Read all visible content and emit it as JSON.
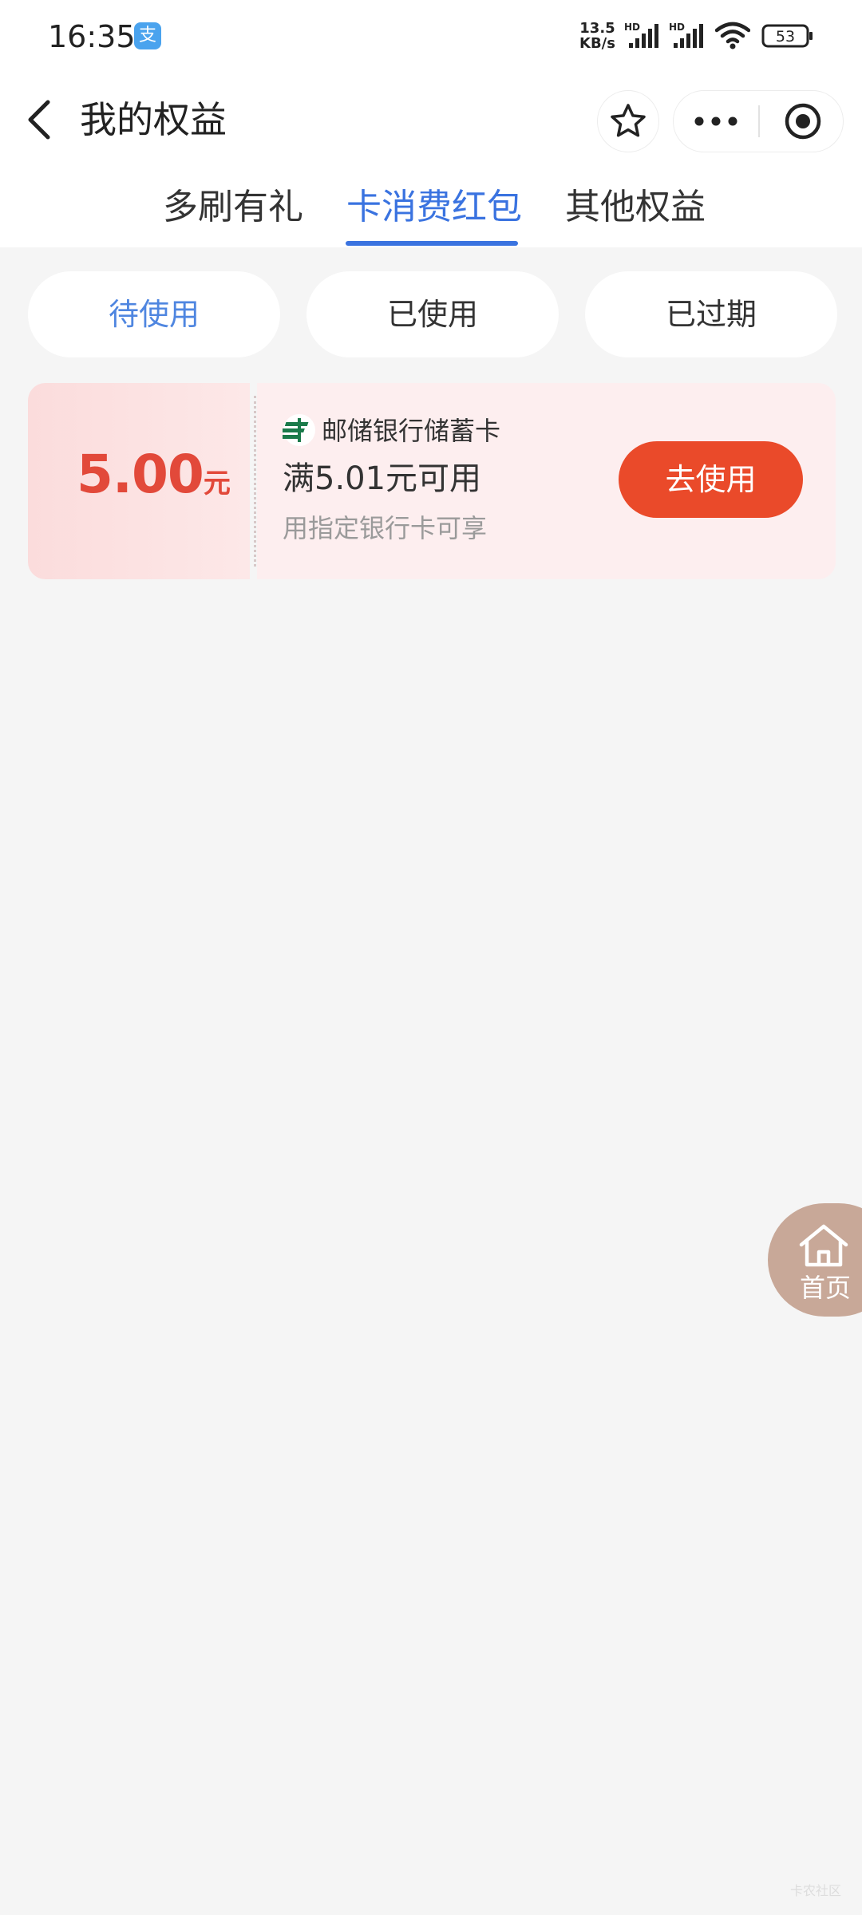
{
  "status_bar": {
    "time": "16:35",
    "app_badge": "支",
    "net_speed_value": "13.5",
    "net_speed_unit": "KB/s",
    "signal_1_label": "HD",
    "signal_2_label": "HD",
    "battery": "53"
  },
  "nav": {
    "title": "我的权益"
  },
  "tabs": [
    {
      "label": "多刷有礼"
    },
    {
      "label": "卡消费红包",
      "active": true
    },
    {
      "label": "其他权益"
    }
  ],
  "filters": [
    {
      "label": "待使用",
      "active": true
    },
    {
      "label": "已使用"
    },
    {
      "label": "已过期"
    }
  ],
  "coupons": [
    {
      "amount": "5.00",
      "unit": "元",
      "bank": "邮储银行储蓄卡",
      "condition": "满5.01元可用",
      "scope": "用指定银行卡可享",
      "action": "去使用"
    }
  ],
  "home_fab": {
    "label": "首页"
  },
  "watermark": "卡农社区",
  "colors": {
    "accent_blue": "#3a73e0",
    "coupon_red": "#e2493a",
    "button_red": "#ea4a2a",
    "home_fab": "#c8a898"
  }
}
